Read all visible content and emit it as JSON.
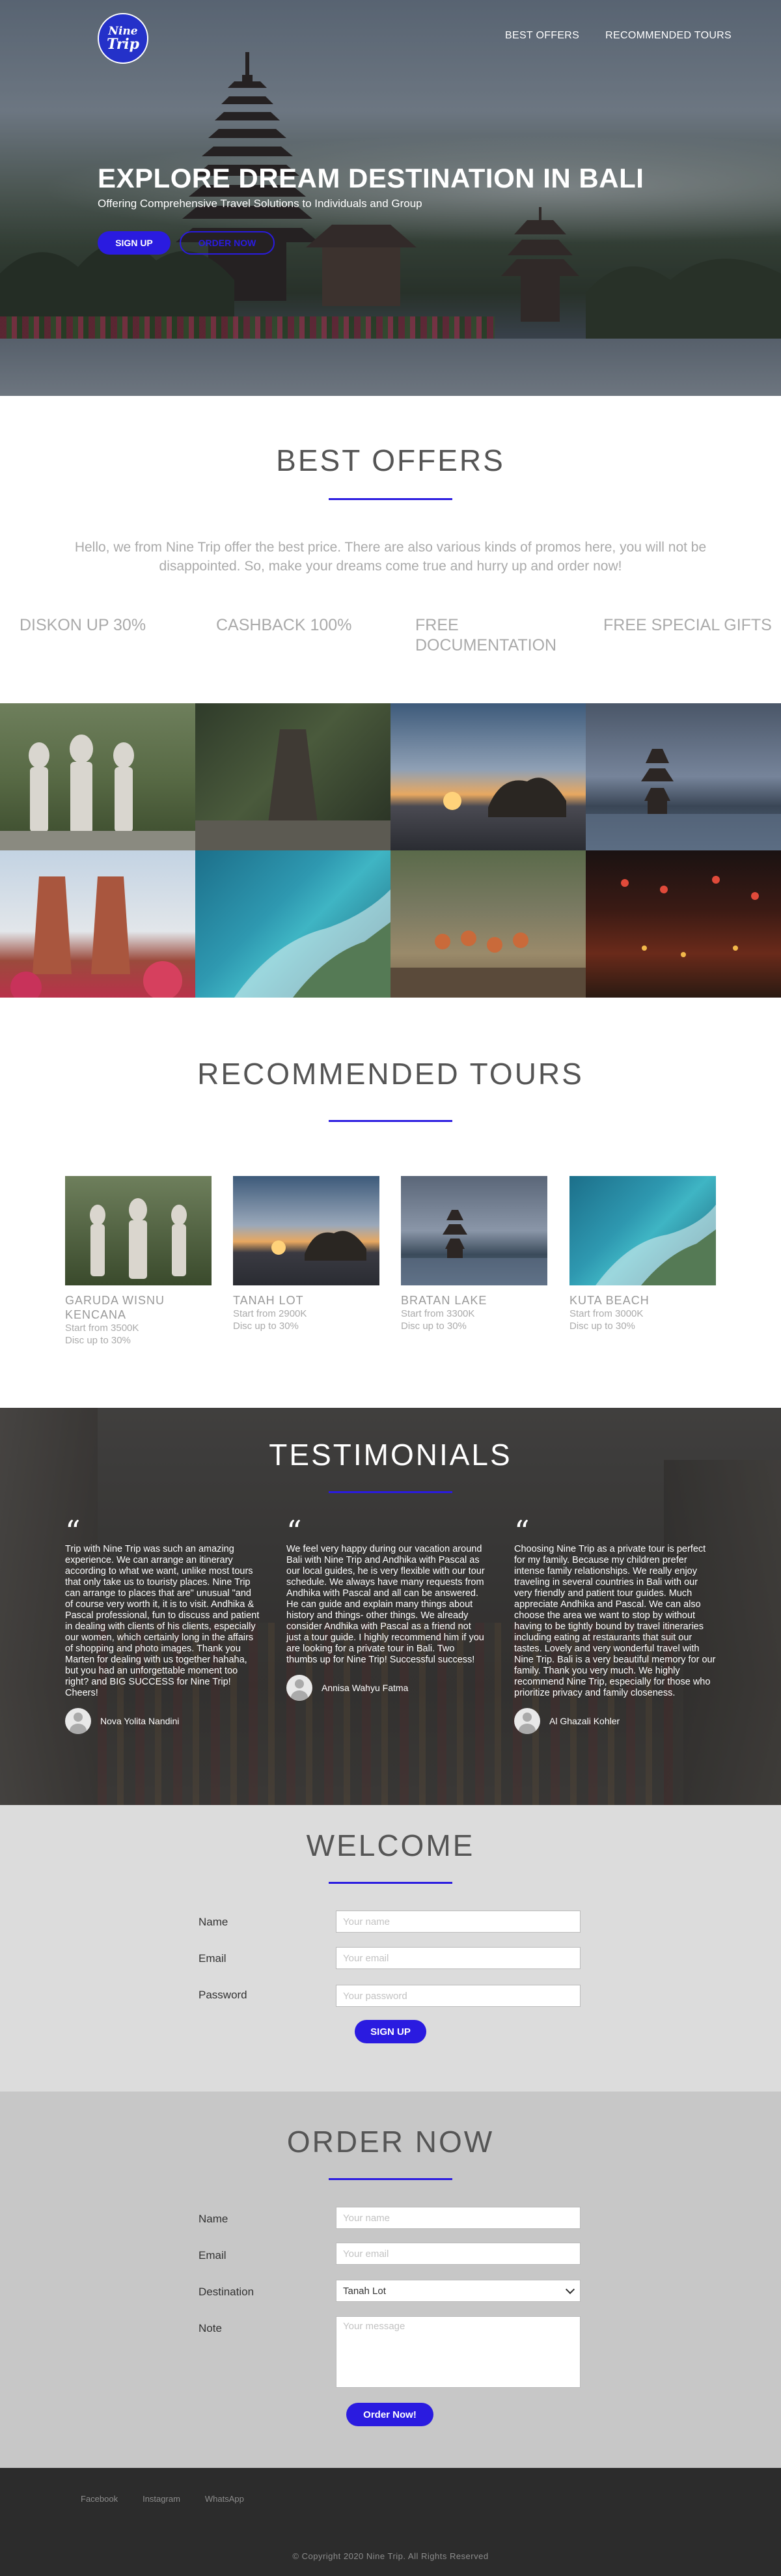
{
  "header": {
    "logo_line1": "Nine",
    "logo_line2": "Trip",
    "nav": [
      "BEST OFFERS",
      "RECOMMENDED TOURS"
    ]
  },
  "hero": {
    "title": "EXPLORE DREAM DESTINATION IN BALI",
    "subtitle": "Offering Comprehensive Travel Solutions to Individuals and Group",
    "signup_label": "SIGN UP",
    "order_label": "ORDER NOW"
  },
  "best_offers": {
    "title": "BEST OFFERS",
    "description": "Hello, we from Nine Trip offer the best price. There are also various kinds of promos here, you will not be disappointed. So, make your dreams come true and hurry up and order now!",
    "promos": [
      "DISKON UP 30%",
      "CASHBACK 100%",
      "FREE DOCUMENTATION",
      "FREE SPECIAL GIFTS"
    ]
  },
  "gallery": {
    "tiles": [
      "garuda-wisnu-kencana",
      "temple-gate-jungle",
      "tanah-lot-sunset",
      "bratan-lake",
      "candi-bentar-flowers",
      "kuta-beach-aerial",
      "kecak-dance-procession",
      "night-festival"
    ]
  },
  "recommended": {
    "title": "RECOMMENDED TOURS",
    "tours": [
      {
        "name": "GARUDA WISNU KENCANA",
        "price": "Start from 3500K",
        "discount": "Disc up to 30%"
      },
      {
        "name": "TANAH LOT",
        "price": "Start from 2900K",
        "discount": "Disc up to 30%"
      },
      {
        "name": "BRATAN LAKE",
        "price": "Start from 3300K",
        "discount": "Disc up to 30%"
      },
      {
        "name": "KUTA BEACH",
        "price": "Start from 3000K",
        "discount": "Disc up to 30%"
      }
    ]
  },
  "testimonials": {
    "title": "TESTIMONIALS",
    "items": [
      {
        "text": "Trip with Nine Trip was such an amazing experience. We can arrange an itinerary according to what we want, unlike most tours that only take us to touristy places. Nine Trip can arrange to places that are\" unusual \"and of course very worth it, it is to visit. Andhika & Pascal professional, fun to discuss and patient in dealing with clients of his clients, especially our women, which certainly long in the affairs of shopping and photo images. Thank you Marten for dealing with us together hahaha, but you had an unforgettable moment too right? and BIG SUCCESS for Nine Trip! Cheers!",
        "author": "Nova Yolita Nandini"
      },
      {
        "text": "We feel very happy during our vacation around Bali with Nine Trip and Andhika with Pascal as our local guides, he is very flexible with our tour schedule. We always have many requests from Andhika with Pascal and all can be answered. He can guide and explain many things about history and things- other things. We already consider Andhika with Pascal as a friend not just a tour guide. I highly recommend him if you are looking for a private tour in Bali. Two thumbs up for Nine Trip! Successful success!",
        "author": "Annisa Wahyu Fatma"
      },
      {
        "text": "Choosing Nine Trip as a private tour is perfect for my family. Because my children prefer intense family relationships. We really enjoy traveling in several countries in Bali with our very friendly and patient tour guides. Much appreciate Andhika and Pascal. We can also choose the area we want to stop by without having to be tightly bound by travel itineraries including eating at restaurants that suit our tastes. Lovely and very wonderful travel with Nine Trip. Bali is a very beautiful memory for our family. Thank you very much. We highly recommend Nine Trip, especially for those who prioritize privacy and family closeness.",
        "author": "Al Ghazali Kohler"
      }
    ]
  },
  "welcome": {
    "title": "WELCOME",
    "name_label": "Name",
    "name_placeholder": "Your name",
    "email_label": "Email",
    "email_placeholder": "Your email",
    "password_label": "Password",
    "password_placeholder": "Your password",
    "submit_label": "SIGN UP"
  },
  "order": {
    "title": "ORDER NOW",
    "name_label": "Name",
    "name_placeholder": "Your name",
    "email_label": "Email",
    "email_placeholder": "Your email",
    "destination_label": "Destination",
    "destination_value": "Tanah Lot",
    "note_label": "Note",
    "note_placeholder": "Your message",
    "submit_label": "Order Now!"
  },
  "footer": {
    "social": [
      "Facebook",
      "Instagram",
      "WhatsApp"
    ],
    "copyright": "© Copyright 2020 Nine Trip. All Rights Reserved"
  },
  "colors": {
    "accent": "#2a1be0",
    "footer_bg": "#2c2c2c",
    "welcome_bg": "#dcdcdc",
    "order_bg": "#c7c7c7"
  }
}
